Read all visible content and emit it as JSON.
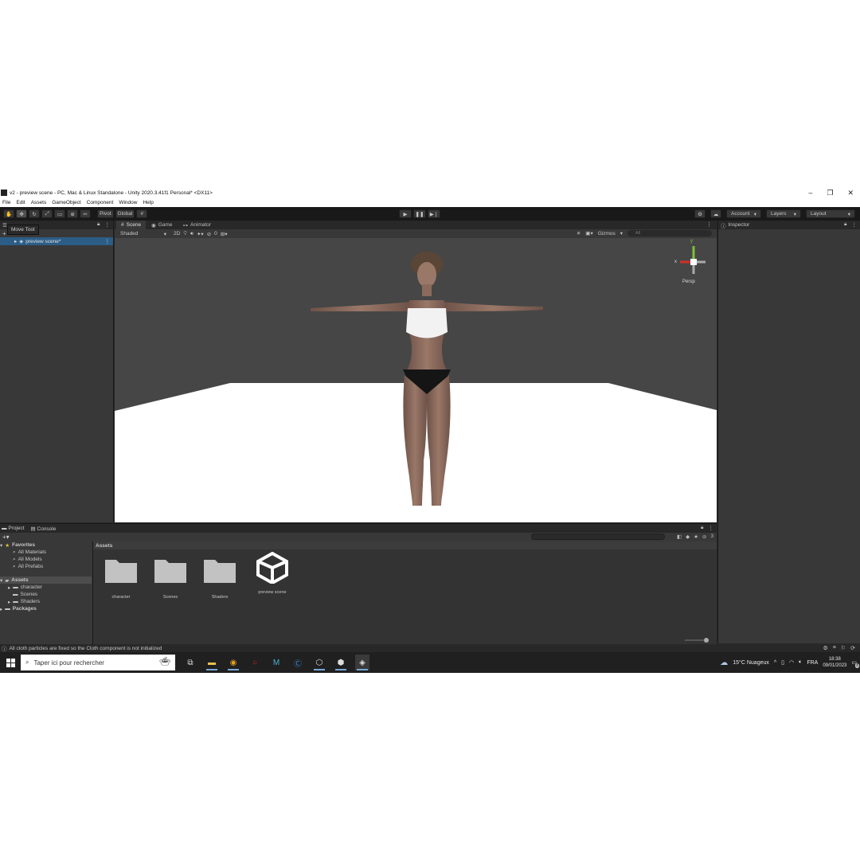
{
  "window": {
    "title": "v2 - preview scene - PC, Mac & Linux Standalone - Unity 2020.3.41f1 Personal* <DX11>",
    "buttons": [
      "–",
      "❐",
      "✕"
    ]
  },
  "menu": [
    "File",
    "Edit",
    "Assets",
    "GameObject",
    "Component",
    "Window",
    "Help"
  ],
  "toolbar": {
    "pivot": "Pivot",
    "global": "Global",
    "account": "Account",
    "layers": "Layers",
    "layout": "Layout"
  },
  "tooltip": "Move Tool",
  "hierarchy": {
    "scene_name": "preview scene*"
  },
  "scene": {
    "tabs": [
      "Scene",
      "Game",
      "Animator"
    ],
    "shading": "Shaded",
    "mode_2d": "2D",
    "gizmos": "Gizmos",
    "search_placeholder": "All",
    "hidden_count": "0",
    "persp": "Persp",
    "axis_x": "x",
    "axis_y": "y"
  },
  "inspector": {
    "tab": "Inspector"
  },
  "project": {
    "tabs": [
      "Project",
      "Console"
    ],
    "tree": {
      "favorites": "Favorites",
      "fav_items": [
        "All Materials",
        "All Models",
        "All Prefabs"
      ],
      "assets": "Assets",
      "asset_children": [
        "character",
        "Scenes",
        "Shaders"
      ],
      "packages": "Packages"
    },
    "breadcrumb": "Assets",
    "assets": [
      {
        "name": "character",
        "icon": "folder-icon"
      },
      {
        "name": "Scenes",
        "icon": "folder-icon"
      },
      {
        "name": "Shaders",
        "icon": "folder-icon"
      },
      {
        "name": "preview scene",
        "icon": "unity-scene-icon"
      }
    ],
    "hidden_count": "3"
  },
  "status": {
    "message": "All cloth particles are fixed so the Cloth component is not initialized"
  },
  "taskbar": {
    "search_placeholder": "Taper ici pour rechercher",
    "weather": "15°C  Nuageux",
    "lang": "FRA",
    "time": "18:38",
    "date": "09/01/2023",
    "notif_count": "8"
  },
  "colors": {
    "editor_bg": "#282828",
    "panel_bg": "#383838",
    "selection": "#2c5d87",
    "scene_sky": "#464646",
    "floor": "#ffffff"
  }
}
